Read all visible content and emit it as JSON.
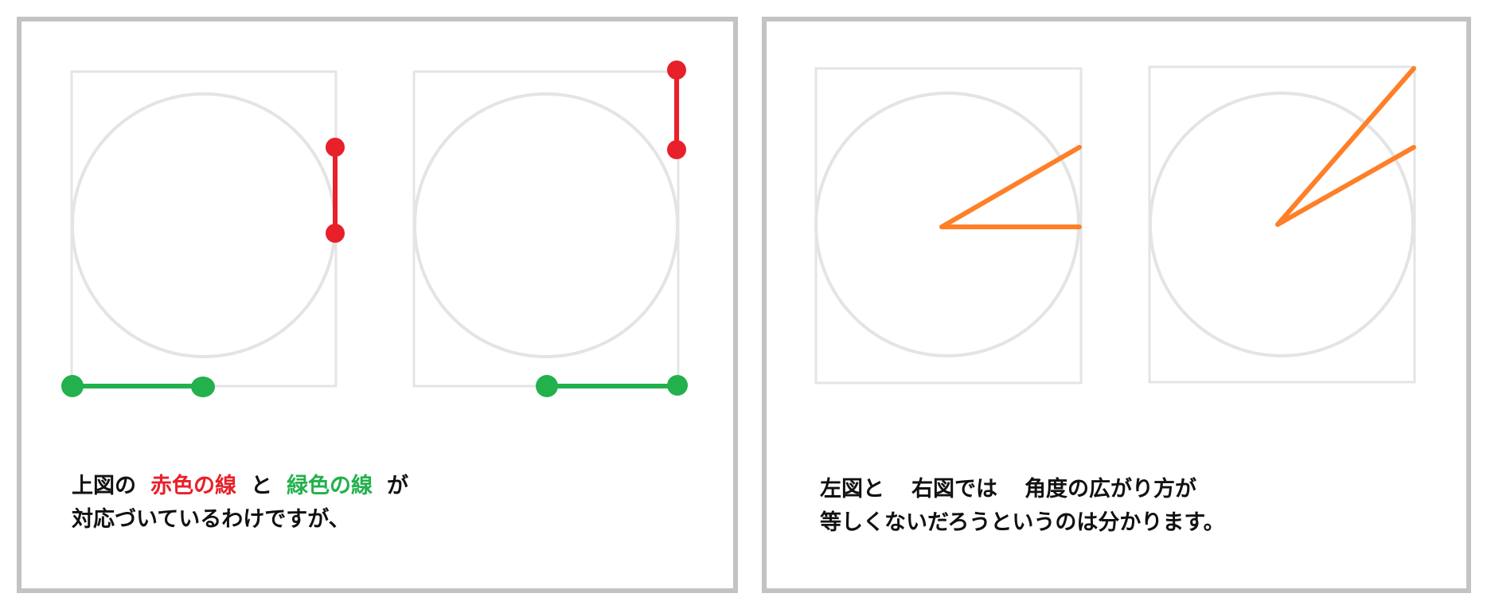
{
  "colors": {
    "panel_border": "#c3c3c3",
    "frame": "#e4e4e4",
    "red": "#e8202a",
    "green": "#22b14c",
    "orange": "#ff7f27",
    "text": "#111111"
  },
  "left_panel": {
    "caption": {
      "line1_prefix": "上図の",
      "red_label": "赤色の線",
      "connector": "と",
      "green_label": "緑色の線",
      "line1_suffix": "が",
      "line2": "対応づいているわけですが、"
    }
  },
  "right_panel": {
    "caption": {
      "left_label": "左図と",
      "right_label": "右図では",
      "angle_label": "角度の広がり方が",
      "line2": "等しくないだろうというのは分かります。"
    }
  }
}
